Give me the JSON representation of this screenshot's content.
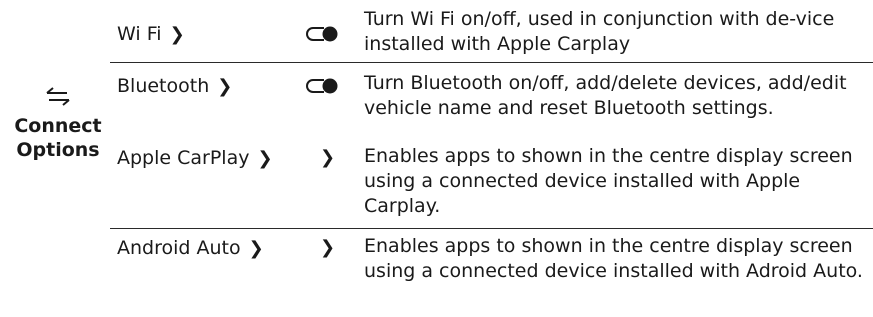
{
  "section": {
    "icon": "swap-arrows-icon",
    "label_line1": "Connect",
    "label_line2": "Options"
  },
  "rows": [
    {
      "name": "Wi Fi",
      "control": "toggle-icon",
      "description": "Turn Wi Fi on/off, used in conjunction with de-vice installed with Apple Carplay"
    },
    {
      "name": "Bluetooth",
      "control": "toggle-icon",
      "description": "Turn Bluetooth on/off, add/delete devices, add/edit vehicle name and reset Bluetooth settings."
    },
    {
      "name": "Apple CarPlay",
      "control": "chevron-right-icon",
      "description": "Enables apps to shown in the centre display screen using a connected device installed with Apple Carplay."
    },
    {
      "name": "Android Auto",
      "control": "chevron-right-icon",
      "description": "Enables apps to shown in the centre display screen using a connected device installed with Adroid Auto."
    }
  ],
  "glyphs": {
    "name_arrow": "❯",
    "chevron": "❯"
  },
  "colors": {
    "text": "#1a1a1a",
    "rule": "#2a2a2a"
  }
}
